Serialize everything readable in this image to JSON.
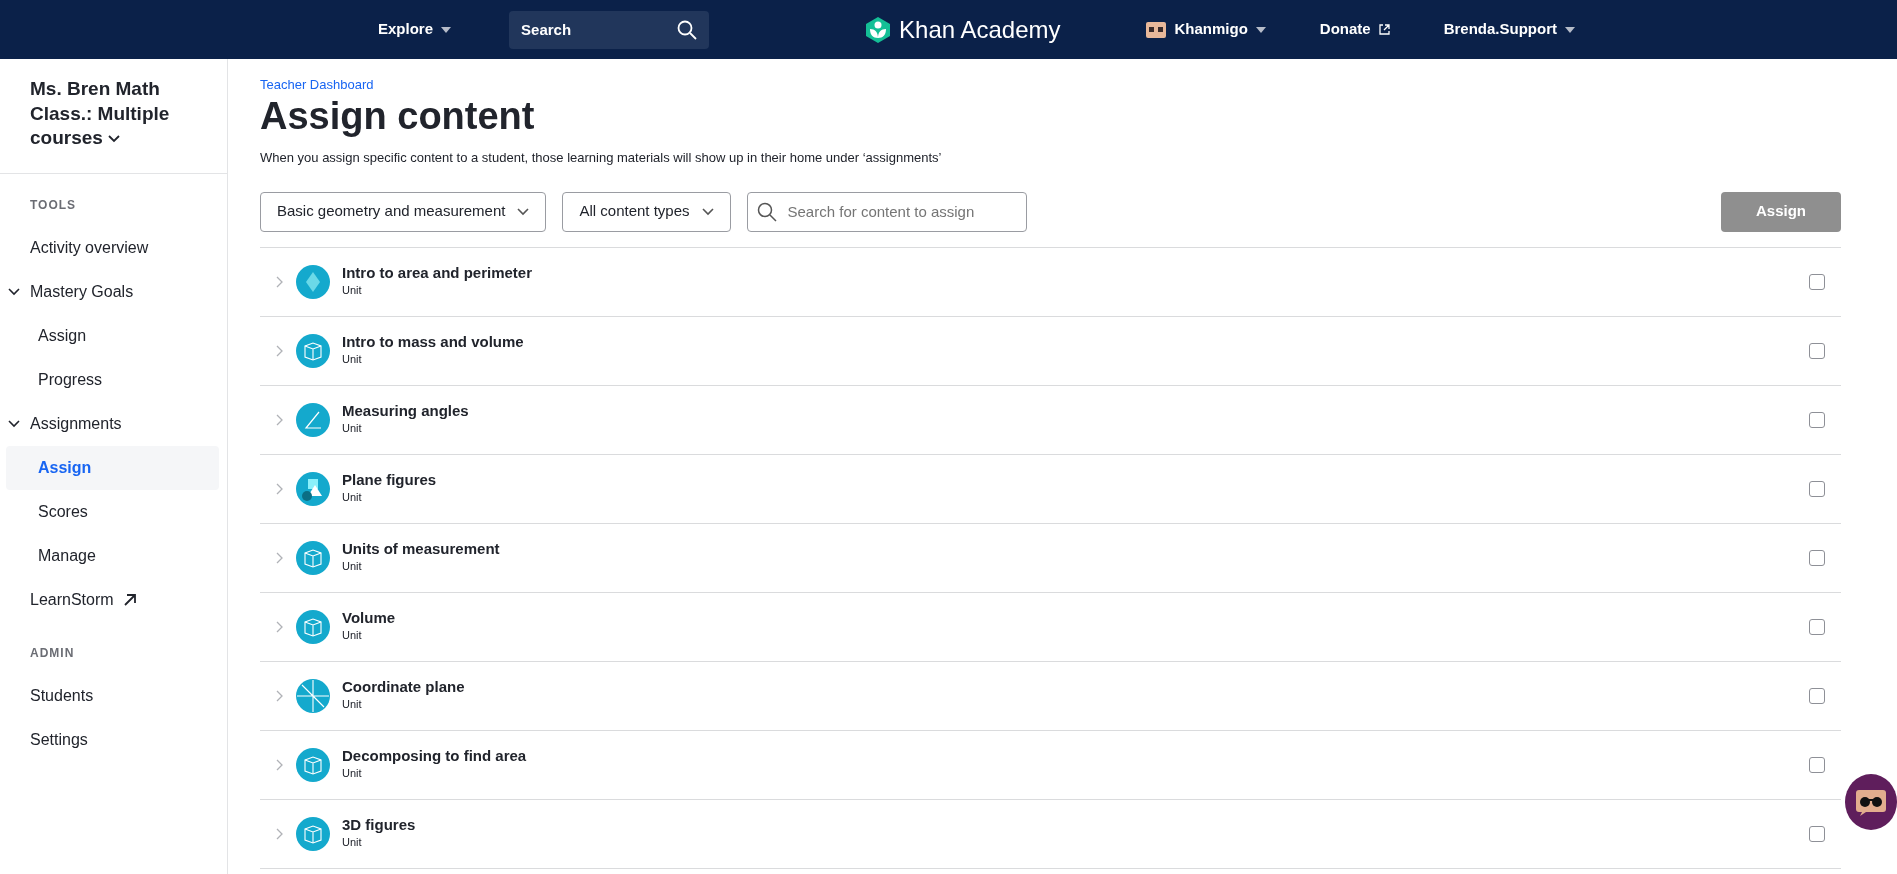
{
  "top_nav": {
    "explore": "Explore",
    "search": {
      "placeholder": "Search"
    },
    "logo": "Khan Academy",
    "khanmigo": "Khanmigo",
    "donate": "Donate",
    "user": "Brenda.Support"
  },
  "sidebar": {
    "class_name": "Ms. Bren Math Class.: Multiple courses",
    "sections": [
      {
        "heading": "TOOLS",
        "items": [
          {
            "label": "Activity overview",
            "kind": "link",
            "selected": false
          },
          {
            "label": "Mastery Goals",
            "kind": "group",
            "expanded": true,
            "selected": false,
            "children": [
              {
                "label": "Assign",
                "kind": "sub",
                "selected": false
              },
              {
                "label": "Progress",
                "kind": "sub",
                "selected": false
              }
            ]
          },
          {
            "label": "Assignments",
            "kind": "group",
            "expanded": true,
            "selected": false,
            "children": [
              {
                "label": "Assign",
                "kind": "sub",
                "selected": true
              },
              {
                "label": "Scores",
                "kind": "sub",
                "selected": false
              },
              {
                "label": "Manage",
                "kind": "sub",
                "selected": false
              }
            ]
          },
          {
            "label": "LearnStorm",
            "kind": "external",
            "selected": false
          }
        ]
      },
      {
        "heading": "ADMIN",
        "items": [
          {
            "label": "Students",
            "kind": "link",
            "selected": false
          },
          {
            "label": "Settings",
            "kind": "link",
            "selected": false
          }
        ]
      }
    ]
  },
  "breadcrumb": "Teacher Dashboard",
  "title": "Assign content",
  "description": "When you assign specific content to a student, those learning materials will show up in their home under ‘assignments’",
  "filters": {
    "course": "Basic geometry and measurement",
    "content_type": "All content types",
    "search": {
      "placeholder": "Search for content to assign"
    },
    "assign_button": {
      "label": "Assign",
      "disabled": true
    }
  },
  "units": [
    {
      "title": "Intro to area and perimeter",
      "type": "Unit",
      "kind": "diamond",
      "checked": false
    },
    {
      "title": "Intro to mass and volume",
      "type": "Unit",
      "kind": "cube",
      "checked": false
    },
    {
      "title": "Measuring angles",
      "type": "Unit",
      "kind": "angle",
      "checked": false
    },
    {
      "title": "Plane figures",
      "type": "Unit",
      "kind": "shapes",
      "checked": false
    },
    {
      "title": "Units of measurement",
      "type": "Unit",
      "kind": "cube",
      "checked": false
    },
    {
      "title": "Volume",
      "type": "Unit",
      "kind": "cube",
      "checked": false
    },
    {
      "title": "Coordinate plane",
      "type": "Unit",
      "kind": "circle",
      "checked": false
    },
    {
      "title": "Decomposing to find area",
      "type": "Unit",
      "kind": "cube",
      "checked": false
    },
    {
      "title": "3D figures",
      "type": "Unit",
      "kind": "cube",
      "checked": false
    }
  ]
}
